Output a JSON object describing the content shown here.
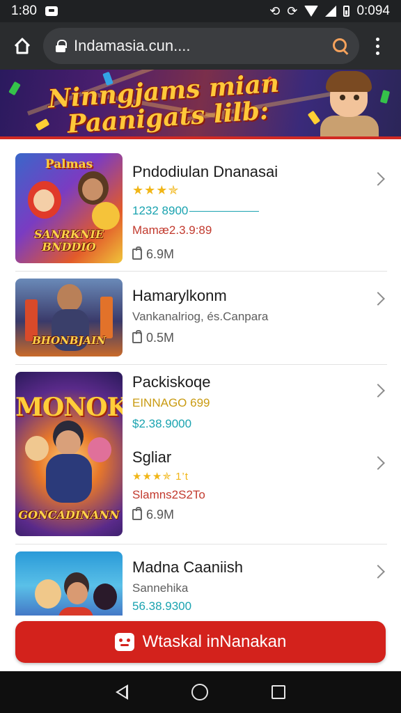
{
  "status_bar": {
    "time": "1:80",
    "battery_text": "0:094"
  },
  "browser": {
    "url": "Indamasia.cun...."
  },
  "banner": {
    "title": "Ninngjams mian\n  Paanigats lilb:"
  },
  "apps": [
    {
      "title": "Pndodiulan Dnanasai",
      "stars": "★★★✯",
      "line_teal": "1232 8900",
      "line_red": "Mamæ2.3.9:89",
      "size": "6.9M",
      "thumb_top": "Palmas",
      "thumb_label": "SANRKNIE\nBNDDIO"
    },
    {
      "title": "Hamarylkonm",
      "line_gray": "Vankanalriog, és.Canpara",
      "size": "0.5M",
      "thumb_label": "BHONBJAIN"
    },
    {
      "title": "Packiskoqe",
      "line_gold": "EINNAGO 699",
      "line_teal": "$2.38.9000",
      "thumb_top": "MONOK",
      "thumb_label": "GONCADINANN"
    },
    {
      "title": "Sgliar",
      "stars": "★★★✯ 1’t",
      "line_red": "Slamns2S2To",
      "size": "6.9M"
    },
    {
      "title": "Madna Caaniish",
      "line_gray": "Sannehika",
      "line_teal": "56.38.9300"
    }
  ],
  "cta": {
    "label": "Wtaskal inNanakan"
  },
  "colors": {
    "accent_red": "#d3221c",
    "teal": "#1aa3b0",
    "star": "#f1b617"
  }
}
